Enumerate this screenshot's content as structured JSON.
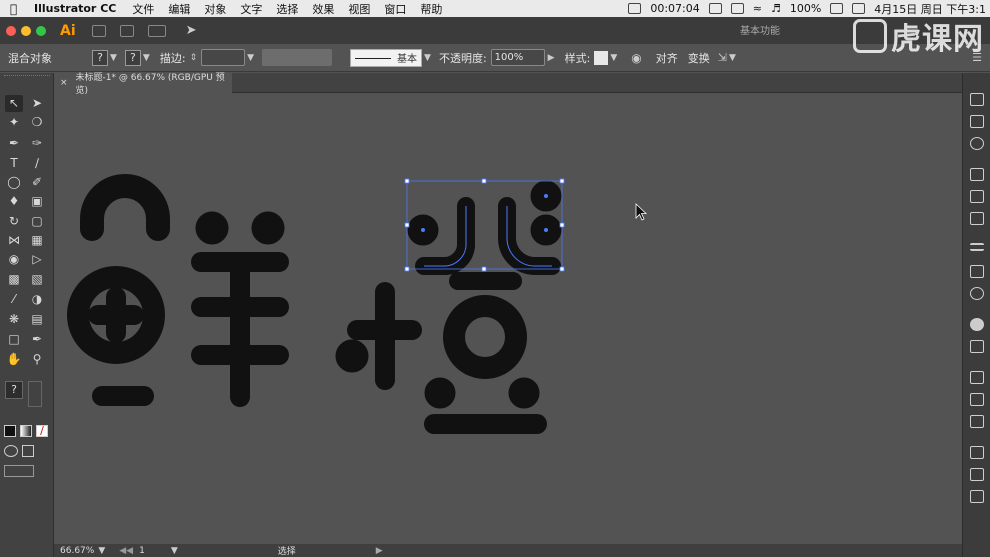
{
  "menubar": {
    "app_name": "Illustrator CC",
    "items": [
      "文件",
      "编辑",
      "对象",
      "文字",
      "选择",
      "效果",
      "视图",
      "窗口",
      "帮助"
    ],
    "clock": "00:07:04",
    "battery": "100%",
    "date": "4月15日 周日 下午3:1"
  },
  "appbar": {
    "logo": "Ai",
    "workspace": "基本功能"
  },
  "control": {
    "selection_type": "混合对象",
    "stroke_label": "描边:",
    "stroke_style": "基本",
    "opacity_label": "不透明度:",
    "opacity_value": "100%",
    "style_label": "样式:",
    "align_label": "对齐",
    "transform_label": "变换"
  },
  "document": {
    "tab_title": "未标题-1* @ 66.67% (RGB/GPU 预览)",
    "close_glyph": "×"
  },
  "status": {
    "zoom": "66.67%",
    "artboard": "1",
    "mode": "选择"
  },
  "watermark": {
    "text": "虎课网"
  },
  "colors": {
    "canvas": "#535353",
    "panel": "#424242",
    "glyph": "#111111",
    "selection": "#4a7bff",
    "menubar": "#eaeaea"
  },
  "icons": {
    "selection_tool": "selection-arrow-icon",
    "direct_selection_tool": "direct-selection-icon",
    "help": "?"
  }
}
